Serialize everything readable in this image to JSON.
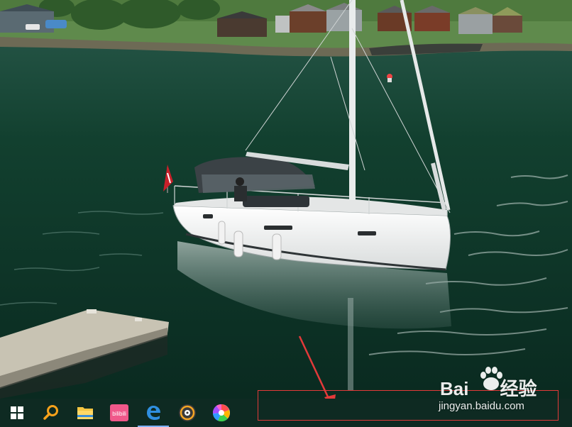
{
  "taskbar": {
    "items": [
      {
        "name": "windows-start-icon",
        "active": false
      },
      {
        "name": "search-icon",
        "active": false
      },
      {
        "name": "file-explorer-icon",
        "active": false
      },
      {
        "name": "bilibili-icon",
        "active": false
      },
      {
        "name": "edge-browser-icon",
        "active": true
      },
      {
        "name": "music-player-icon",
        "active": false
      },
      {
        "name": "colorful-app-icon",
        "active": false
      }
    ],
    "bilibili_label": "bilibili"
  },
  "watermark": {
    "brand_left": "Bai",
    "brand_right": "经验",
    "url": "jingyan.baidu.com"
  },
  "annotation": {
    "color": "#e23a3a"
  },
  "colors": {
    "water": "#0f3a2e",
    "taskbar": "#0e2a22",
    "accent": "#7fb2ff"
  }
}
